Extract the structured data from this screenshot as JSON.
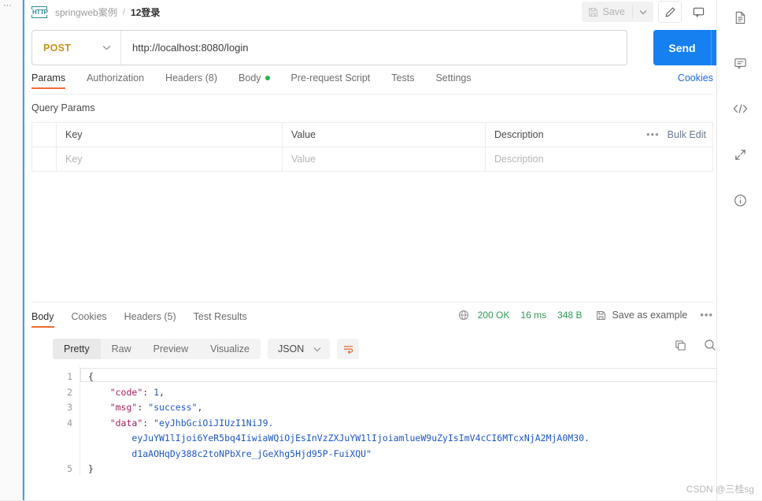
{
  "app": {
    "watermark": "CSDN @三桂sg"
  },
  "header": {
    "icon": "http-protocol-icon",
    "collection": "springweb案例",
    "separator": "/",
    "request_name": "12登录",
    "save_label": "Save",
    "save_caret_icon": "chevron-down-icon",
    "save_disk_icon": "floppy-disk-icon",
    "edit_icon": "pencil-icon",
    "comment_icon": "comment-icon"
  },
  "url_bar": {
    "method": "POST",
    "method_caret_icon": "chevron-down-icon",
    "url": "http://localhost:8080/login",
    "send_label": "Send",
    "send_caret_icon": "chevron-down-icon",
    "method_color": "#c4911c",
    "send_color": "#1680f0"
  },
  "request_tabs": {
    "items": [
      {
        "label": "Params",
        "active": true,
        "dot": false
      },
      {
        "label": "Authorization",
        "active": false,
        "dot": false
      },
      {
        "label": "Headers (8)",
        "active": false,
        "dot": false
      },
      {
        "label": "Body",
        "active": false,
        "dot": true
      },
      {
        "label": "Pre-request Script",
        "active": false,
        "dot": false
      },
      {
        "label": "Tests",
        "active": false,
        "dot": false
      },
      {
        "label": "Settings",
        "active": false,
        "dot": false
      }
    ],
    "cookies_link": "Cookies",
    "active_underline_color": "#ef6c33",
    "dot_color": "#28b550"
  },
  "query_params": {
    "title": "Query Params",
    "headers": {
      "key": "Key",
      "value": "Value",
      "description": "Description"
    },
    "bulk_edit_label": "Bulk Edit",
    "more_icon": "ellipsis-icon",
    "rows": [
      {
        "key": "Key",
        "value": "Value",
        "description": "Description",
        "placeholder": true
      }
    ]
  },
  "response": {
    "tabs": [
      {
        "label": "Body",
        "active": true
      },
      {
        "label": "Cookies",
        "active": false
      },
      {
        "label": "Headers (5)",
        "active": false
      },
      {
        "label": "Test Results",
        "active": false
      }
    ],
    "headers_count_text": "(5)",
    "globe_icon": "globe-icon",
    "status": "200 OK",
    "time": "16 ms",
    "size": "348 B",
    "save_example_label": "Save as example",
    "save_example_icon": "floppy-disk-icon",
    "more_icon": "ellipsis-icon",
    "status_color": "#2f9c53"
  },
  "format_bar": {
    "modes": [
      {
        "label": "Pretty",
        "active": true
      },
      {
        "label": "Raw",
        "active": false
      },
      {
        "label": "Preview",
        "active": false
      },
      {
        "label": "Visualize",
        "active": false
      }
    ],
    "language": "JSON",
    "language_caret_icon": "chevron-down-icon",
    "wrap_icon": "word-wrap-icon",
    "copy_icon": "copy-icon",
    "search_icon": "search-icon"
  },
  "code": {
    "line_numbers": [
      "1",
      "2",
      "3",
      "4",
      "5"
    ],
    "lines": [
      {
        "n": "1",
        "raw": "{"
      },
      {
        "n": "2",
        "raw": "    \"code\": 1,"
      },
      {
        "n": "3",
        "raw": "    \"msg\": \"success\","
      },
      {
        "n": "4",
        "raw": "    \"data\": \"eyJhbGciOiJIUzI1NiJ9."
      },
      {
        "n": "",
        "raw": "        eyJuYW1lIjoi6YeR5bq4IiwiaWQiOjEsInVzZXJuYW1lIjoiamlueW9uZyIsImV4cCI6MTcxNjA2MjA0M30."
      },
      {
        "n": "",
        "raw": "        d1aAOHqDy388c2toNPbXre_jGeXhg5Hjd95P-FuiXQU\""
      },
      {
        "n": "5",
        "raw": "}"
      }
    ],
    "json_object": {
      "code": 1,
      "msg": "success",
      "data": "eyJhbGciOiJIUzI1NiJ9.eyJuYW1lIjoi6YeR5bq4IiwiaWQiOjEsInVzZXJuYW1lIjoiamlueW9uZyIsImV4cCI6MTcxNjA2MjA0M30.d1aAOHqDy388c2toNPbXre_jGeXhg5Hjd95P-FuiXQU"
    },
    "tokens": {
      "brace_open": "{",
      "brace_close": "}",
      "k_code": "\"code\"",
      "v_code": "1",
      "k_msg": "\"msg\"",
      "v_msg": "\"success\"",
      "k_data": "\"data\"",
      "v_data_l1": "\"eyJhbGciOiJIUzI1NiJ9.",
      "v_data_l2": "eyJuYW1lIjoi6YeR5bq4IiwiaWQiOjEsInVzZXJuYW1lIjoiamlueW9uZyIsImV4cCI6MTcxNjA2MjA0M30.",
      "v_data_l3": "d1aAOHqDy388c2toNPbXre_jGeXhg5Hjd95P-FuiXQU\"",
      "colon_comma": ",",
      "colon": ":"
    }
  },
  "right_rail": {
    "items": [
      {
        "icon": "document-icon",
        "name": "documentation"
      },
      {
        "icon": "comment-icon",
        "name": "comments"
      },
      {
        "icon": "code-icon",
        "name": "code-snippet"
      },
      {
        "icon": "expand-arrows-icon",
        "name": "related-requests"
      },
      {
        "icon": "info-circle-icon",
        "name": "request-info"
      }
    ]
  }
}
